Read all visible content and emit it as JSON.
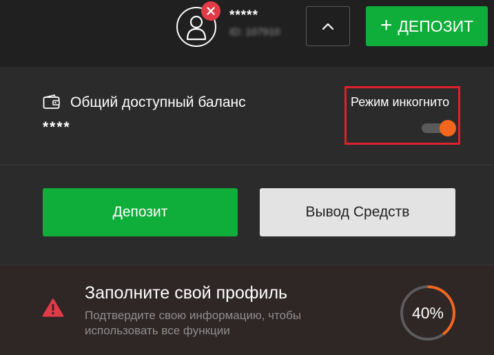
{
  "header": {
    "username": "*****",
    "account_id": "ID: 107910",
    "deposit_label": "ДЕПОЗИТ"
  },
  "balance": {
    "label": "Общий доступный баланс",
    "value": "****"
  },
  "incognito": {
    "label": "Режим инкогнито",
    "enabled": true
  },
  "actions": {
    "deposit_label": "Депозит",
    "withdraw_label": "Вывод Средств"
  },
  "profile": {
    "title": "Заполните свой профиль",
    "subtitle": "Подтвердите свою информацию, чтобы использовать все функции",
    "progress_text": "40%",
    "progress_fraction": 0.4
  },
  "colors": {
    "accent_green": "#0fad3a",
    "accent_orange": "#f2661e",
    "alert_red": "#e23b48",
    "highlight_red": "#e0202a"
  },
  "icons": [
    "user-avatar-icon",
    "close-icon",
    "chevron-up-icon",
    "plus-icon",
    "wallet-icon",
    "warning-icon"
  ]
}
